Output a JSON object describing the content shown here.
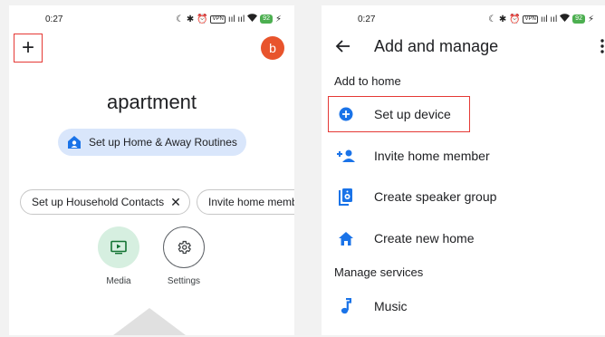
{
  "left": {
    "status": {
      "time": "0:27",
      "icons": "☾ ✱ ⏰",
      "vpn": "VPN",
      "signal": "ııl ııl",
      "battery": "92"
    },
    "avatar_letter": "b",
    "home_name": "apartment",
    "routine_chip": "Set up Home & Away Routines",
    "suggestion_chips": [
      "Set up Household Contacts",
      "Invite home memb"
    ],
    "chip_close": "✕",
    "actions": [
      {
        "label": "Media"
      },
      {
        "label": "Settings"
      }
    ]
  },
  "right": {
    "status": {
      "time": "0:27",
      "icons": "☾ ✱ ⏰",
      "vpn": "VPN",
      "signal": "ııl ııl",
      "battery": "92"
    },
    "title": "Add and manage",
    "section_add": "Add to home",
    "items": [
      {
        "label": "Set up device",
        "icon": "add-circle-icon"
      },
      {
        "label": "Invite home member",
        "icon": "person-add-icon"
      },
      {
        "label": "Create speaker group",
        "icon": "speaker-group-icon"
      },
      {
        "label": "Create new home",
        "icon": "home-icon"
      }
    ],
    "section_manage": "Manage services",
    "service_items": [
      {
        "label": "Music",
        "icon": "music-note-icon"
      }
    ]
  },
  "colors": {
    "accent": "#1a73e8",
    "highlight_border": "#e53935",
    "avatar": "#e8542c",
    "chip_bg": "#d9e6fb"
  }
}
